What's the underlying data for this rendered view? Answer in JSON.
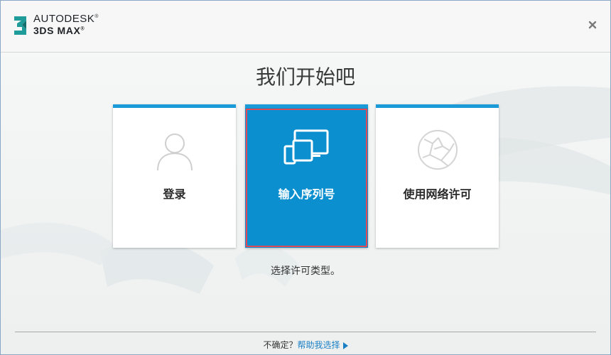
{
  "app": {
    "brand_line1": "AUTODESK",
    "brand_line2": "3DS MAX",
    "registered_mark": "®",
    "logo_number": "3"
  },
  "header": {
    "close_icon": "close-icon"
  },
  "main": {
    "title": "我们开始吧",
    "options": [
      {
        "label": "登录",
        "icon": "user-silhouette-icon",
        "selected": false
      },
      {
        "label": "输入序列号",
        "icon": "devices-icon",
        "selected": true
      },
      {
        "label": "使用网络许可",
        "icon": "network-globe-icon",
        "selected": false
      }
    ],
    "hint": "选择许可类型。"
  },
  "footer": {
    "question": "不确定？",
    "help_link": "帮助我选择"
  },
  "colors": {
    "accent": "#1a9ad6",
    "selected_bg": "#0b8fcf",
    "selected_outline": "#e04a58",
    "link": "#1a7fc4"
  }
}
